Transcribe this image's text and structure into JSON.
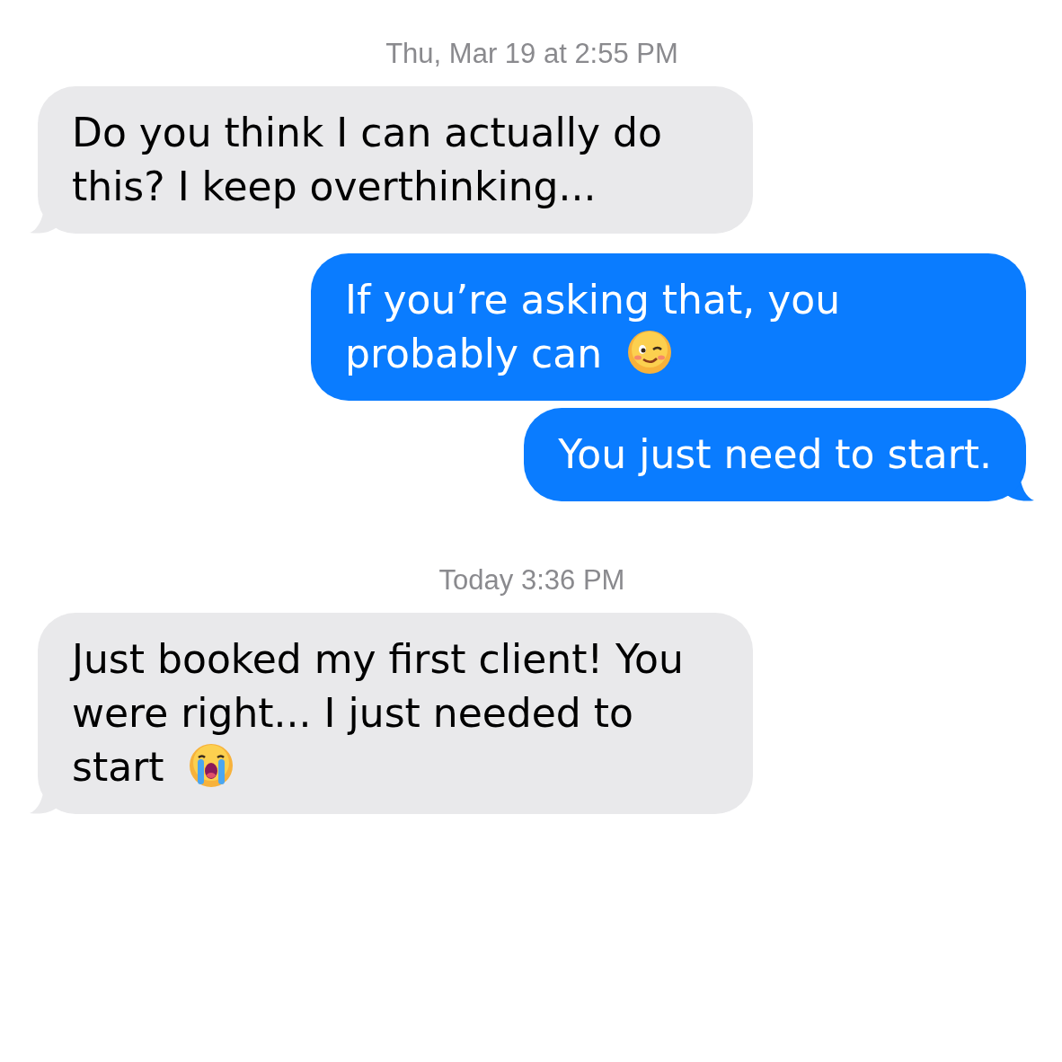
{
  "thread": [
    {
      "kind": "timestamp",
      "text": "Thu, Mar 19 at 2:55 PM"
    },
    {
      "kind": "received",
      "text": "Do you think I can actually do this? I keep overthinking...",
      "tail": true
    },
    {
      "kind": "sent",
      "text": "If you’re asking that, you probably can",
      "emoji": {
        "kind": "wink"
      },
      "tail": false
    },
    {
      "kind": "sent",
      "text": "You just need to start.",
      "tail": true
    },
    {
      "kind": "timestamp",
      "text": "Today 3:36 PM"
    },
    {
      "kind": "received",
      "text": "Just booked my first client! You were right... I just needed to start",
      "emoji": {
        "kind": "crying"
      },
      "tail": true
    }
  ]
}
